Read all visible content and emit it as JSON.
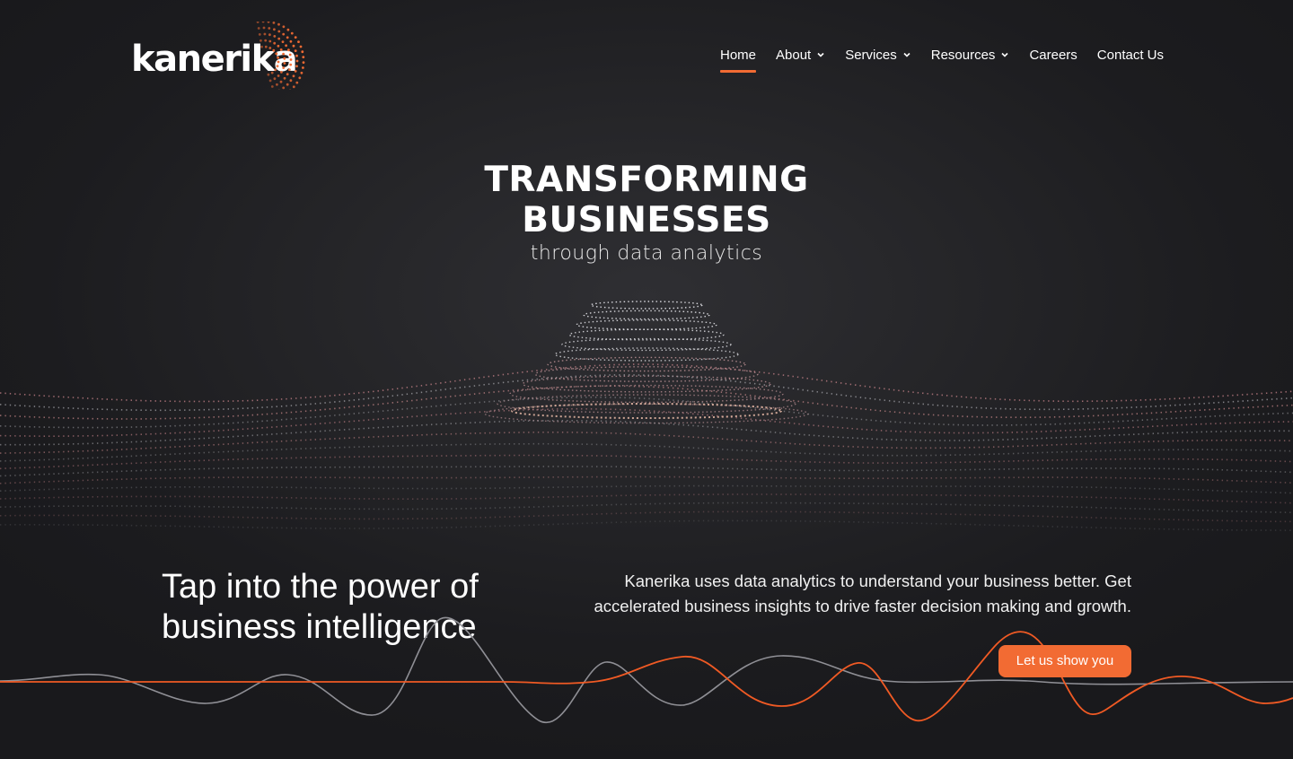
{
  "brand": {
    "name": "kanerika",
    "accent": "#f26b33"
  },
  "nav": {
    "items": [
      {
        "label": "Home",
        "active": true,
        "dropdown": false
      },
      {
        "label": "About",
        "active": false,
        "dropdown": true
      },
      {
        "label": "Services",
        "active": false,
        "dropdown": true
      },
      {
        "label": "Resources",
        "active": false,
        "dropdown": true
      },
      {
        "label": "Careers",
        "active": false,
        "dropdown": false
      },
      {
        "label": "Contact Us",
        "active": false,
        "dropdown": false
      }
    ]
  },
  "hero": {
    "title_line1": "TRANSFORMING",
    "title_line2": "BUSINESSES",
    "subtitle": "through data analytics"
  },
  "intro": {
    "tagline_line1": "Tap into the power of",
    "tagline_line2": "business intelligence",
    "description": "Kanerika uses data analytics to understand your business better. Get accelerated business insights to drive faster decision making and growth.",
    "cta_label": "Let us show you"
  },
  "icons": {
    "dropdown": "chevron-down-icon",
    "logo_mark": "dotted-arc-icon"
  }
}
